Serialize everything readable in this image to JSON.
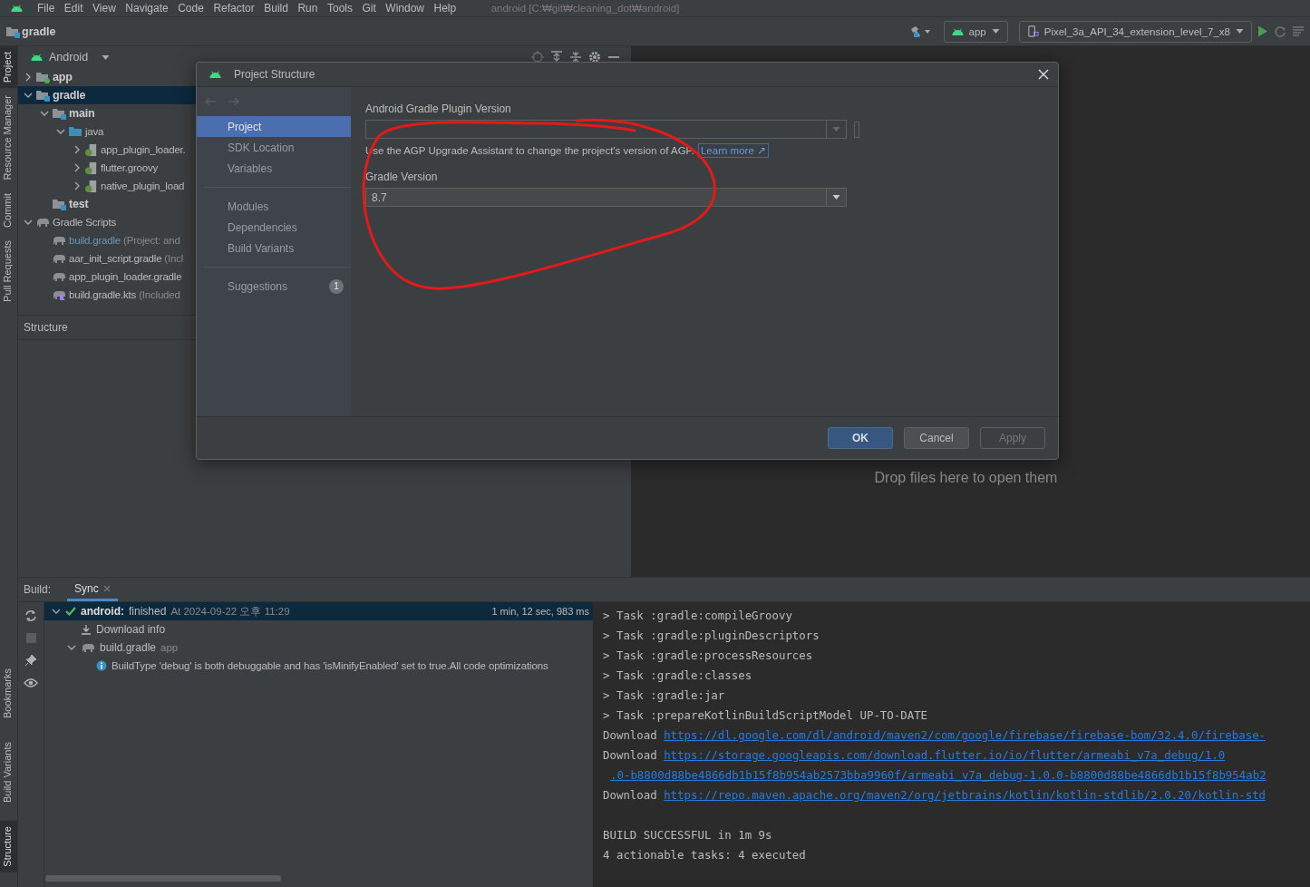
{
  "menu_bar": {
    "items": [
      "File",
      "Edit",
      "View",
      "Navigate",
      "Code",
      "Refactor",
      "Build",
      "Run",
      "Tools",
      "Git",
      "Window",
      "Help"
    ],
    "title": "android [C:₩git₩cleaning_dot₩android]"
  },
  "nav_bar": {
    "breadcrumb": "gradle",
    "run_config": "app",
    "device": "Pixel_3a_API_34_extension_level_7_x8"
  },
  "tool_strip": {
    "top": [
      {
        "label": "Project",
        "selected": true
      },
      {
        "label": "Resource Manager",
        "selected": false
      },
      {
        "label": "Commit",
        "selected": false
      },
      {
        "label": "Pull Requests",
        "selected": false
      }
    ],
    "bottom": [
      {
        "label": "Bookmarks",
        "selected": false
      },
      {
        "label": "Build Variants",
        "selected": false
      },
      {
        "label": "Structure",
        "selected": true
      }
    ]
  },
  "project_panel": {
    "view": "Android",
    "tree": [
      {
        "kind": "app_module",
        "label": "app",
        "expanded": false,
        "selected": false
      },
      {
        "kind": "module",
        "label": "gradle",
        "expanded": true,
        "selected": true,
        "children": [
          {
            "kind": "module",
            "label": "main",
            "expanded": true,
            "selected": false,
            "children": [
              {
                "kind": "source",
                "label": "java",
                "expanded": true,
                "selected": false,
                "children": [
                  {
                    "kind": "package",
                    "label": "app_plugin_loader.",
                    "expanded": false,
                    "selected": false
                  },
                  {
                    "kind": "package",
                    "label": "flutter.groovy",
                    "expanded": false,
                    "selected": false
                  },
                  {
                    "kind": "package",
                    "label": "native_plugin_load",
                    "expanded": false,
                    "selected": false
                  }
                ]
              }
            ]
          },
          {
            "kind": "module",
            "label": "test",
            "selected": false
          }
        ]
      },
      {
        "kind": "scripts",
        "label": "Gradle Scripts",
        "expanded": true,
        "selected": false,
        "children": [
          {
            "kind": "gradle",
            "label": "build.gradle",
            "note": "(Project: and",
            "changed": true,
            "selected": false
          },
          {
            "kind": "gradle",
            "label": "aar_init_script.gradle",
            "note": "(Incl",
            "changed": false,
            "selected": false
          },
          {
            "kind": "gradle",
            "label": "app_plugin_loader.gradle",
            "changed": false,
            "selected": false
          },
          {
            "kind": "kts",
            "label": "build.gradle.kts",
            "note": "(Included",
            "changed": false,
            "selected": false
          }
        ]
      }
    ],
    "structure_title": "Structure"
  },
  "editor": {
    "empty_hint": "Drop files here to open them"
  },
  "dialog": {
    "title": "Project Structure",
    "nav": [
      {
        "label": "Project",
        "selected": true
      },
      {
        "label": "SDK Location",
        "selected": false
      },
      {
        "label": "Variables",
        "selected": false
      },
      {
        "kind": "divider"
      },
      {
        "label": "Modules",
        "selected": false
      },
      {
        "label": "Dependencies",
        "selected": false
      },
      {
        "label": "Build Variants",
        "selected": false
      },
      {
        "kind": "divider"
      },
      {
        "label": "Suggestions",
        "selected": false,
        "badge": "1"
      }
    ],
    "agp_label": "Android Gradle Plugin Version",
    "agp_disabled": true,
    "hint": "Use the AGP Upgrade Assistant to change the project's version of AGP.",
    "link": "Learn more ↗",
    "gradle_label": "Gradle Version",
    "gradle_value": "8.7",
    "buttons": [
      {
        "label": "OK",
        "kind": "primary",
        "disabled": false
      },
      {
        "label": "Cancel",
        "kind": "normal",
        "disabled": false
      },
      {
        "label": "Apply",
        "kind": "normal",
        "disabled": true
      }
    ]
  },
  "build_panel": {
    "label": "Build:",
    "tabs": [
      {
        "label": "Sync",
        "selected": true
      }
    ],
    "tree": [
      {
        "kind": "result",
        "name": "android:",
        "status": "finished",
        "time": "At 2024-09-22 오후 11:29",
        "duration": "1 min, 12 sec, 983 ms",
        "selected": true,
        "expanded": true,
        "children": [
          {
            "kind": "download",
            "label": "Download info"
          },
          {
            "kind": "file",
            "label": "build.gradle",
            "note": "app",
            "expanded": true,
            "children": [
              {
                "kind": "info",
                "label": "BuildType 'debug' is both debuggable and has 'isMinifyEnabled' set to true.All code optimizations"
              }
            ]
          }
        ]
      }
    ],
    "console": [
      {
        "kind": "text",
        "text": "> Task :gradle:compileGroovy"
      },
      {
        "kind": "text",
        "text": "> Task :gradle:pluginDescriptors"
      },
      {
        "kind": "text",
        "text": "> Task :gradle:processResources"
      },
      {
        "kind": "text",
        "text": "> Task :gradle:classes"
      },
      {
        "kind": "text",
        "text": "> Task :gradle:jar"
      },
      {
        "kind": "text",
        "text": "> Task :prepareKotlinBuildScriptModel UP-TO-DATE"
      },
      {
        "kind": "download",
        "text": "Download",
        "url": "https://dl.google.com/dl/android/maven2/com/google/firebase/firebase-bom/32.4.0/firebase-"
      },
      {
        "kind": "download",
        "text": "Download",
        "url": "https://storage.googleapis.com/download.flutter.io/io/flutter/armeabi_v7a_debug/1.0"
      },
      {
        "kind": "wrap",
        "url": ".0-b8800d88be4866db1b15f8b954ab2573bba9960f/armeabi_v7a_debug-1.0.0-b8800d88be4866db1b15f8b954ab2"
      },
      {
        "kind": "download",
        "text": "Download",
        "url": "https://repo.maven.apache.org/maven2/org/jetbrains/kotlin/kotlin-stdlib/2.0.20/kotlin-std"
      },
      {
        "kind": "blank"
      },
      {
        "kind": "text",
        "text": "BUILD SUCCESSFUL in 1m 9s"
      },
      {
        "kind": "text",
        "text": "4 actionable tasks: 4 executed"
      }
    ]
  }
}
